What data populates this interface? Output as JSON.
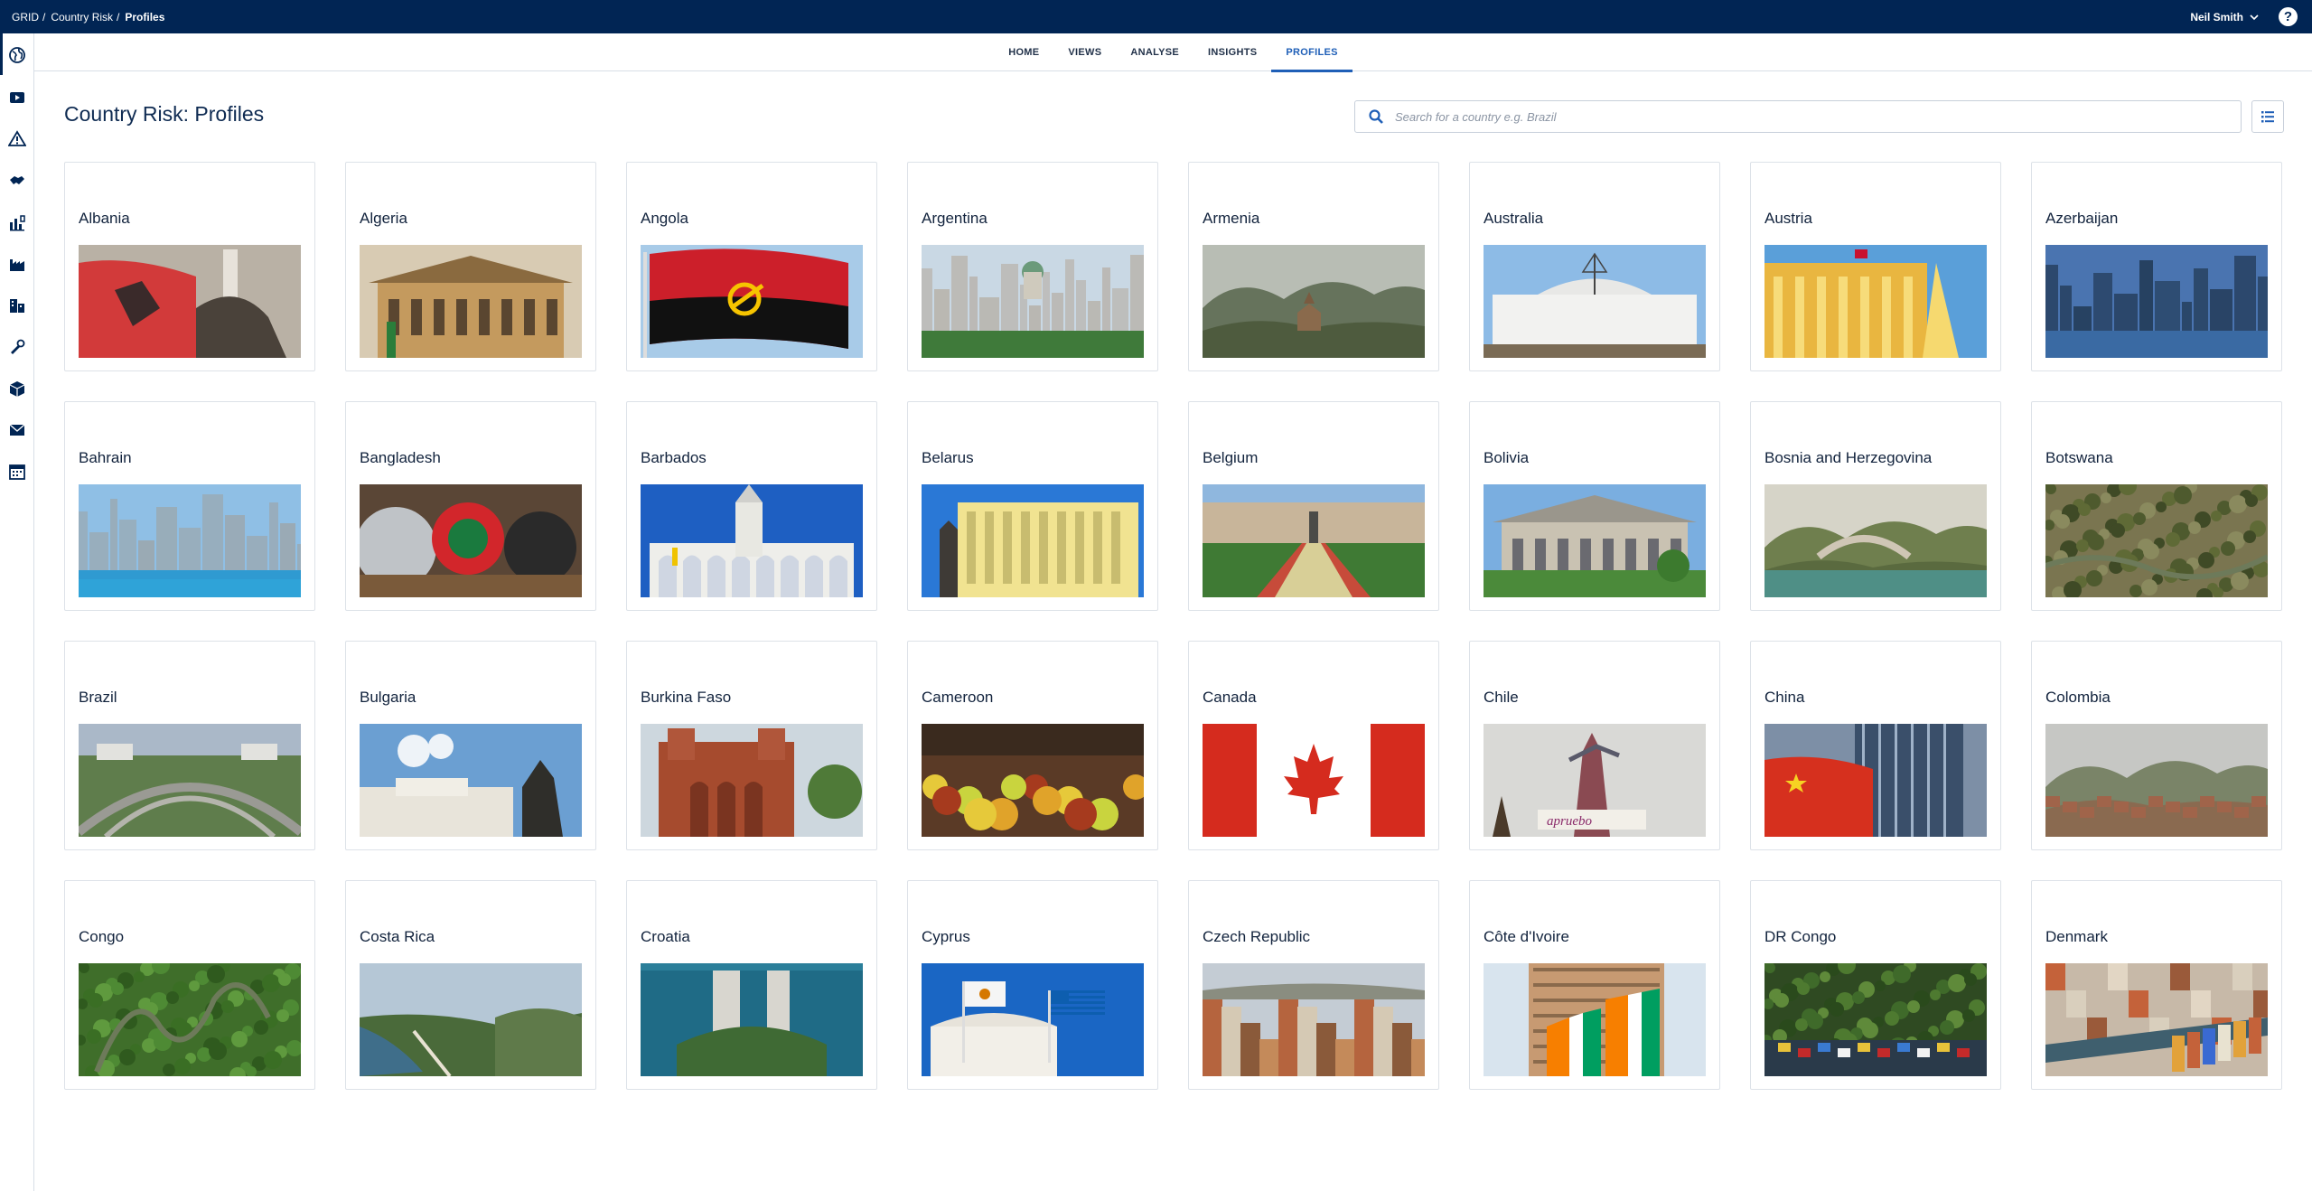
{
  "breadcrumb": [
    {
      "label": "GRID"
    },
    {
      "label": "Country Risk"
    },
    {
      "label": "Profiles"
    }
  ],
  "user": {
    "name": "Neil Smith"
  },
  "help_label": "?",
  "tabs": [
    {
      "label": "HOME"
    },
    {
      "label": "VIEWS"
    },
    {
      "label": "ANALYSE"
    },
    {
      "label": "INSIGHTS"
    },
    {
      "label": "PROFILES",
      "active": true
    }
  ],
  "page_title": "Country Risk: Profiles",
  "search": {
    "placeholder": "Search for a country e.g. Brazil"
  },
  "rail_icons": [
    "globe-icon",
    "play-icon",
    "warning-icon",
    "handshake-icon",
    "industry-chart-icon",
    "factory-icon",
    "buildings-icon",
    "tools-icon",
    "box-icon",
    "mail-icon",
    "calendar-icon"
  ],
  "countries": [
    {
      "name": "Albania",
      "theme": "albania"
    },
    {
      "name": "Algeria",
      "theme": "algeria"
    },
    {
      "name": "Angola",
      "theme": "angola"
    },
    {
      "name": "Argentina",
      "theme": "argentina"
    },
    {
      "name": "Armenia",
      "theme": "armenia"
    },
    {
      "name": "Australia",
      "theme": "australia"
    },
    {
      "name": "Austria",
      "theme": "austria"
    },
    {
      "name": "Azerbaijan",
      "theme": "azerbaijan"
    },
    {
      "name": "Bahrain",
      "theme": "bahrain"
    },
    {
      "name": "Bangladesh",
      "theme": "bangladesh"
    },
    {
      "name": "Barbados",
      "theme": "barbados"
    },
    {
      "name": "Belarus",
      "theme": "belarus"
    },
    {
      "name": "Belgium",
      "theme": "belgium"
    },
    {
      "name": "Bolivia",
      "theme": "bolivia"
    },
    {
      "name": "Bosnia and Herzegovina",
      "theme": "bosnia"
    },
    {
      "name": "Botswana",
      "theme": "botswana"
    },
    {
      "name": "Brazil",
      "theme": "brazil"
    },
    {
      "name": "Bulgaria",
      "theme": "bulgaria"
    },
    {
      "name": "Burkina Faso",
      "theme": "burkina"
    },
    {
      "name": "Cameroon",
      "theme": "cameroon"
    },
    {
      "name": "Canada",
      "theme": "canada"
    },
    {
      "name": "Chile",
      "theme": "chile"
    },
    {
      "name": "China",
      "theme": "china"
    },
    {
      "name": "Colombia",
      "theme": "colombia"
    },
    {
      "name": "Congo",
      "theme": "congo"
    },
    {
      "name": "Costa Rica",
      "theme": "costarica"
    },
    {
      "name": "Croatia",
      "theme": "croatia"
    },
    {
      "name": "Cyprus",
      "theme": "cyprus"
    },
    {
      "name": "Czech Republic",
      "theme": "czech"
    },
    {
      "name": "Côte d'Ivoire",
      "theme": "ivoire"
    },
    {
      "name": "DR Congo",
      "theme": "drcongo"
    },
    {
      "name": "Denmark",
      "theme": "denmark"
    }
  ]
}
